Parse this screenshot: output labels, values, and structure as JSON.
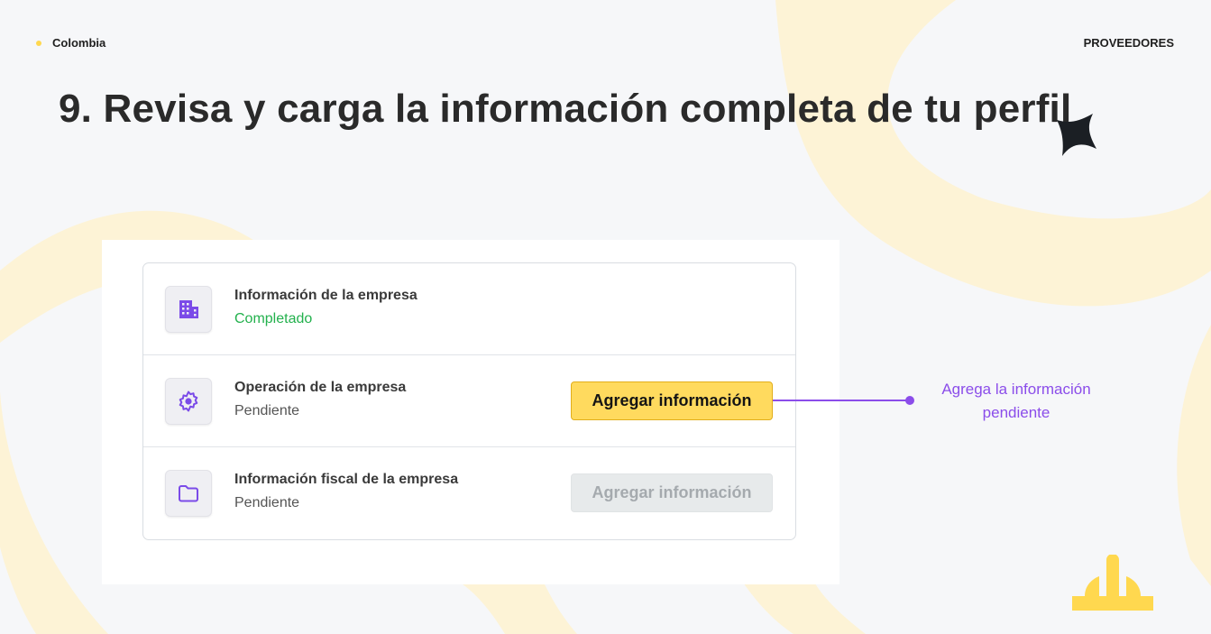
{
  "header": {
    "region": "Colombia",
    "section": "PROVEEDORES"
  },
  "page_title": "9. Revisa y carga la información completa de tu perfil",
  "profile_sections": [
    {
      "title": "Información de la empresa",
      "status": "Completado",
      "icon": "building-icon"
    },
    {
      "title": "Operación de la empresa",
      "status": "Pendiente",
      "icon": "gear-icon",
      "button_label": "Agregar información",
      "button_state": "enabled"
    },
    {
      "title": "Información fiscal de la empresa",
      "status": "Pendiente",
      "icon": "folder-icon",
      "button_label": "Agregar información",
      "button_state": "disabled"
    }
  ],
  "callout": {
    "line1": "Agrega la información",
    "line2": "pendiente"
  },
  "colors": {
    "accent_yellow": "#ffd84f",
    "button_yellow": "#ffda5e",
    "callout_purple": "#8b4dea",
    "icon_purple": "#7b4be8",
    "status_green": "#23b14d"
  }
}
